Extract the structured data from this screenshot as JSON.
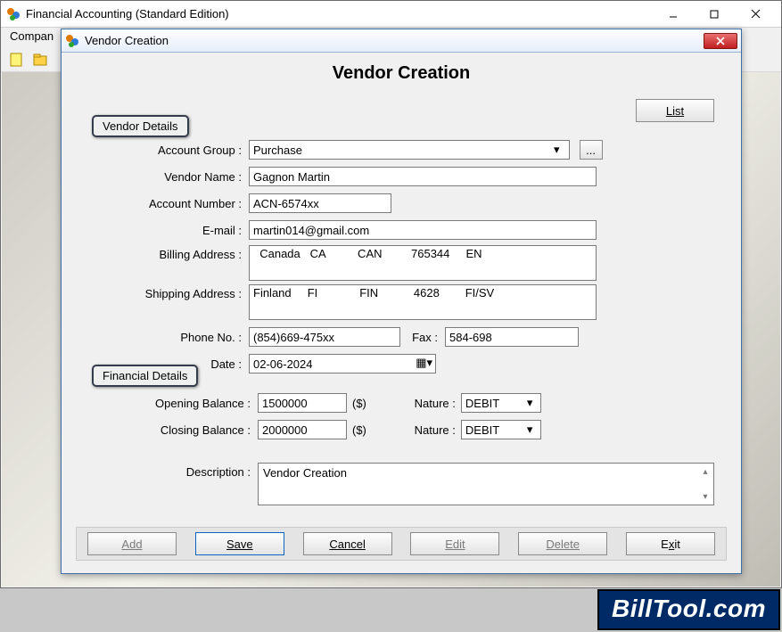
{
  "main_window": {
    "title": "Financial Accounting (Standard Edition)",
    "menu_first": "Compan"
  },
  "watermark": "BillTool.com",
  "dialog": {
    "title": "Vendor Creation",
    "page_title": "Vendor Creation",
    "list_label": "List",
    "section_vendor": "Vendor Details",
    "section_financial": "Financial Details",
    "labels": {
      "account_group": "Account Group  :",
      "vendor_name": "Vendor Name  :",
      "account_number": "Account Number  :",
      "email": "E-mail  :",
      "billing_address": "Billing Address  :",
      "shipping_address": "Shipping Address  :",
      "phone": "Phone No.  :",
      "fax": "Fax  :",
      "date": "Date  :",
      "opening": "Opening Balance  :",
      "closing": "Closing Balance  :",
      "currency": "($)",
      "nature": "Nature  :",
      "description": "Description  :"
    },
    "values": {
      "account_group": "Purchase",
      "vendor_name": "Gagnon Martin",
      "account_number": "ACN-6574xx",
      "email": "martin014@gmail.com",
      "billing_address": "  Canada   CA          CAN         765344     EN",
      "shipping_address": "Finland     FI             FIN           4628        FI/SV",
      "phone": "(854)669-475xx",
      "fax": "584-698",
      "date": "02-06-2024",
      "opening": "1500000",
      "closing": "2000000",
      "nature1": "DEBIT",
      "nature2": "DEBIT",
      "description": "Vendor Creation"
    },
    "buttons": {
      "add": "Add",
      "save": "Save",
      "cancel": "Cancel",
      "edit": "Edit",
      "delete": "Delete",
      "exit": "Exit"
    },
    "ellipsis": "..."
  }
}
